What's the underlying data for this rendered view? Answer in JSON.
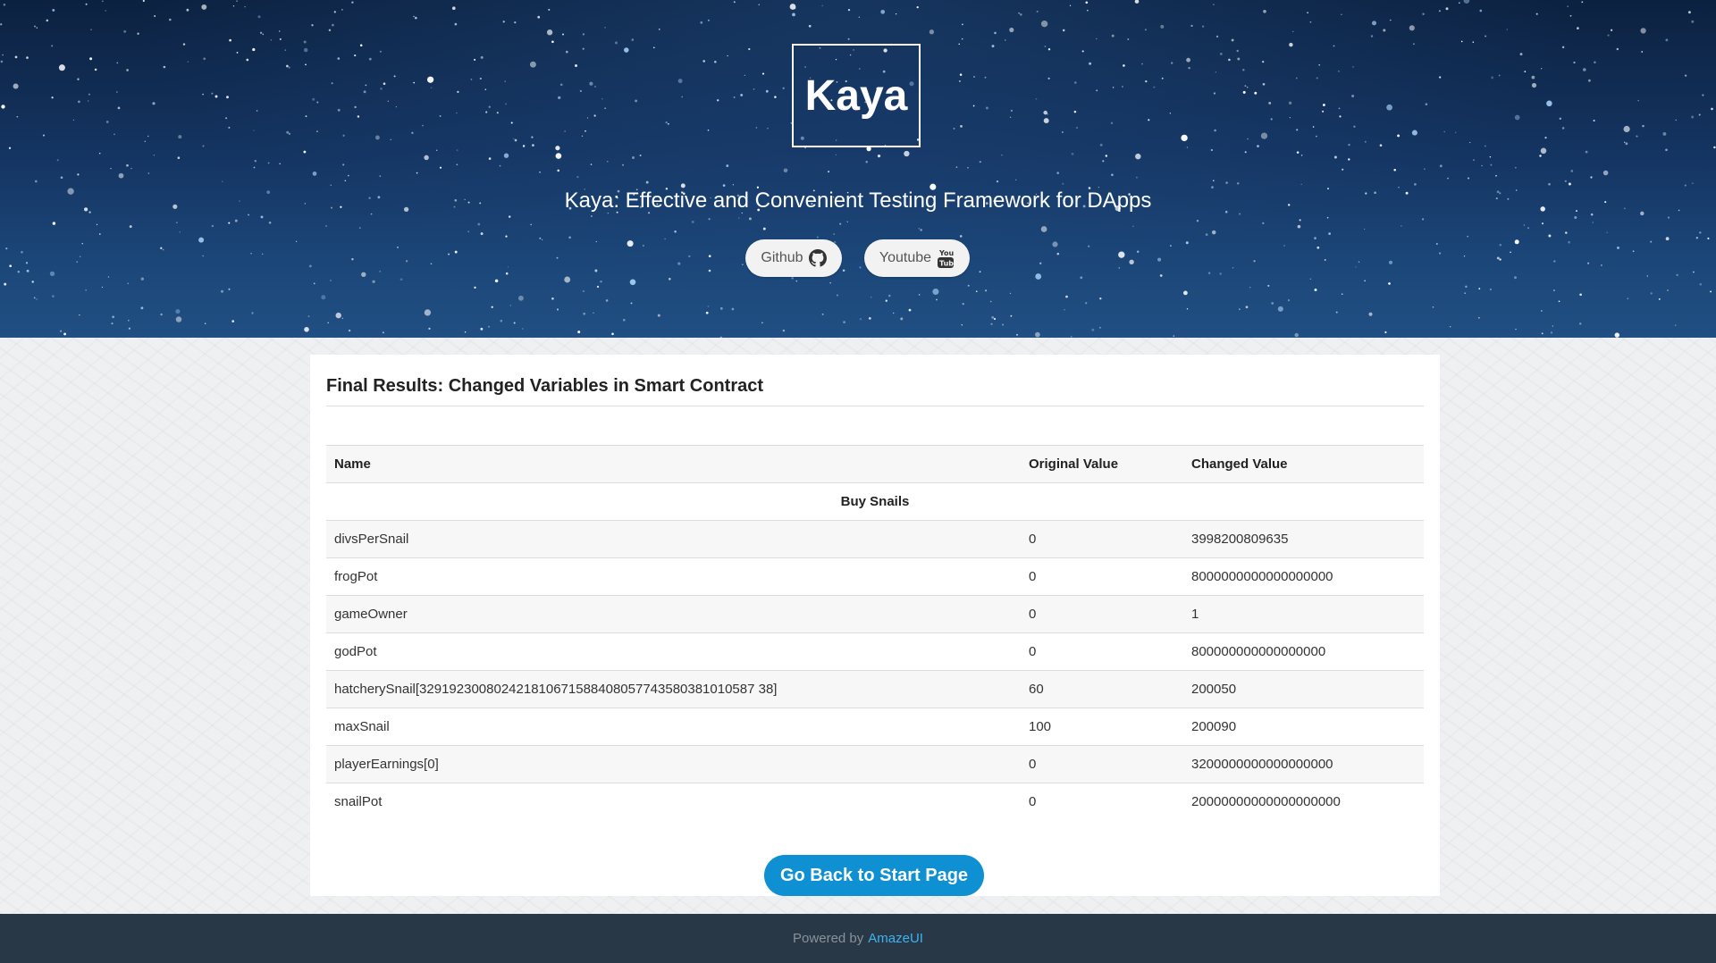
{
  "header": {
    "logo_text": "Kaya",
    "tagline": "Kaya: Effective and Convenient Testing Framework for DApps",
    "buttons": [
      {
        "label": "Github",
        "icon": "github-icon"
      },
      {
        "label": "Youtube",
        "icon": "youtube-icon"
      }
    ]
  },
  "results": {
    "title": "Final Results: Changed Variables in Smart Contract",
    "columns": [
      "Name",
      "Original Value",
      "Changed Value"
    ],
    "group_label": "Buy Snails",
    "rows": [
      {
        "name": "divsPerSnail",
        "original": "0",
        "changed": "3998200809635"
      },
      {
        "name": "frogPot",
        "original": "0",
        "changed": "8000000000000000000"
      },
      {
        "name": "gameOwner",
        "original": "0",
        "changed": "1"
      },
      {
        "name": "godPot",
        "original": "0",
        "changed": "800000000000000000"
      },
      {
        "name": "hatcherySnail[329192300802421810671588408057743580381010587 38]",
        "original": "60",
        "changed": "200050"
      },
      {
        "name": "maxSnail",
        "original": "100",
        "changed": "200090"
      },
      {
        "name": "playerEarnings[0]",
        "original": "0",
        "changed": "3200000000000000000"
      },
      {
        "name": "snailPot",
        "original": "0",
        "changed": "20000000000000000000"
      }
    ],
    "back_button_label": "Go Back to Start Page"
  },
  "footer": {
    "prefix": "Powered by",
    "link_text": "AmazeUI"
  },
  "colors": {
    "primary_button": "#0e90d2",
    "footer_bg": "#283846",
    "footer_link": "#3bb4f2"
  }
}
